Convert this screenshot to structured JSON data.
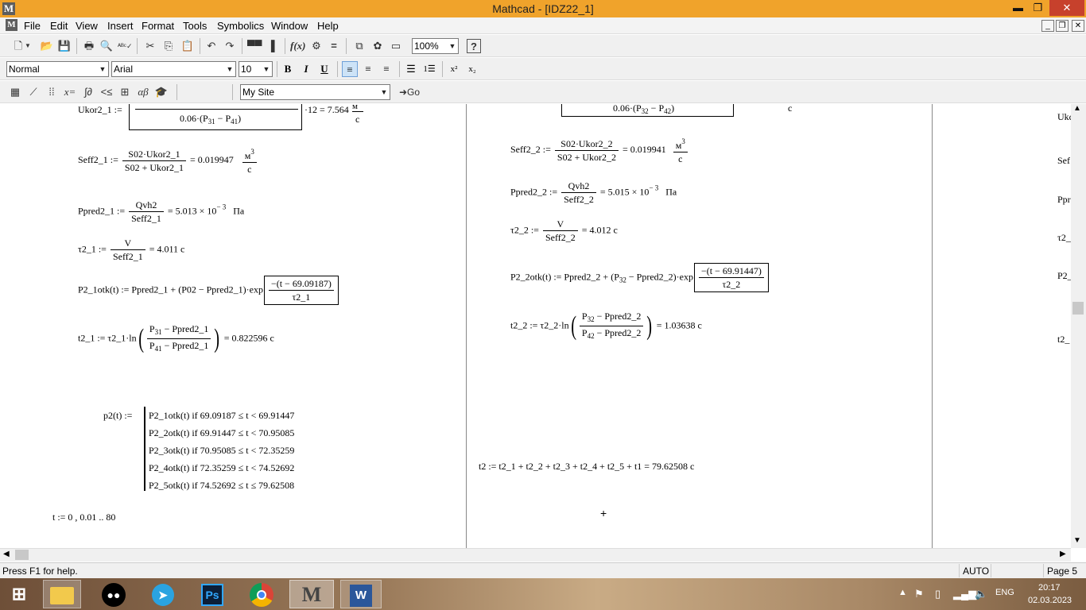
{
  "window": {
    "app_icon": "M",
    "title": "Mathcad - [IDZ22_1]",
    "minimize": "▬",
    "maximize": "❐",
    "close": "✕"
  },
  "menu": [
    "File",
    "Edit",
    "View",
    "Insert",
    "Format",
    "Tools",
    "Symbolics",
    "Window",
    "Help"
  ],
  "standard_toolbar": {
    "zoom": "100%",
    "icons": [
      "new-icon",
      "open-icon",
      "save-icon",
      "print-icon",
      "preview-icon",
      "spellcheck-icon",
      "cut-icon",
      "copy-icon",
      "paste-icon",
      "undo-icon",
      "redo-icon",
      "align-across-icon",
      "align-down-icon",
      "insert-function-icon",
      "insert-unit-icon",
      "calculate-icon",
      "resources-icon",
      "component-icon",
      "insert-region-icon",
      "help-icon"
    ]
  },
  "format_toolbar": {
    "style": "Normal",
    "font": "Arial",
    "size": "10",
    "bold": "B",
    "italic": "I",
    "underline": "U"
  },
  "math_toolbar": {
    "site": "My Site",
    "go": "Go"
  },
  "doc": {
    "ukor": {
      "lhs": "Ukor2_1 :=",
      "den_pre": "0.06·(P",
      "den_s1": "31",
      "den_mid": " − P",
      "den_s2": "41",
      "den_post": ")",
      "rhs": "·12 = 7.564",
      "unit_n": "м",
      "unit_d": "с"
    },
    "ukor_r": {
      "den_pre": "0.06·(P",
      "den_s1": "32",
      "den_mid": " − P",
      "den_s2": "42",
      "den_post": ")",
      "unit": "с"
    },
    "seff1": {
      "lhs": "Seff2_1 :=",
      "num": "S02·Ukor2_1",
      "den": "S02 + Ukor2_1",
      "rhs": "= 0.019947",
      "unit_n": "м",
      "unit_sup": "3",
      "unit_d": "с"
    },
    "ppred1": {
      "lhs": "Ppred2_1 :=",
      "num": "Qvh2",
      "den": "Seff2_1",
      "rhs": "= 5.013 × 10",
      "exp": "− 3",
      "unit": "Па"
    },
    "tau1": {
      "lhs": "τ2_1 :=",
      "num": "V",
      "den": "Seff2_1",
      "rhs": "= 4.011  с"
    },
    "p21": {
      "lhs": "P2_1otk(t) := Ppred2_1 + (P02 − Ppred2_1)·exp",
      "num": "−(t − 69.09187)",
      "den": "τ2_1"
    },
    "t21": {
      "lhs": "t2_1 := τ2_1·ln",
      "num_a": "P",
      "num_s": "31",
      "num_b": " − Ppred2_1",
      "den_a": "P",
      "den_s": "41",
      "den_b": " − Ppred2_1",
      "rhs": "= 0.822596   с"
    },
    "piecewise": {
      "lhs": "p2(t) :=",
      "rows": [
        "P2_1otk(t)   if   69.09187 ≤ t < 69.91447",
        "P2_2otk(t)   if   69.91447 ≤ t < 70.95085",
        "P2_3otk(t)   if   70.95085 ≤ t < 72.35259",
        "P2_4otk(t)   if   72.35259 ≤ t < 74.52692",
        "P2_5otk(t)   if   74.52692 ≤ t ≤ 79.62508"
      ]
    },
    "trange": "t := 0 , 0.01 .. 80",
    "seff2": {
      "lhs": "Seff2_2 :=",
      "num": "S02·Ukor2_2",
      "den": "S02 + Ukor2_2",
      "rhs": "= 0.019941",
      "unit_n": "м",
      "unit_sup": "3",
      "unit_d": "с"
    },
    "ppred2": {
      "lhs": "Ppred2_2 :=",
      "num": "Qvh2",
      "den": "Seff2_2",
      "rhs": "= 5.015 × 10",
      "exp": "− 3",
      "unit": "Па"
    },
    "tau2": {
      "lhs": "τ2_2 :=",
      "num": "V",
      "den": "Seff2_2",
      "rhs": "= 4.012  с"
    },
    "p22": {
      "lhs": "P2_2otk(t) := Ppred2_2 + (P",
      "s": "32",
      "mid": " − Ppred2_2)·exp",
      "num": "−(t − 69.91447)",
      "den": "τ2_2"
    },
    "t22": {
      "lhs": "t2_2 := τ2_2·ln",
      "num_a": "P",
      "num_s": "32",
      "num_b": " − Ppred2_2",
      "den_a": "P",
      "den_s": "42",
      "den_b": " − Ppred2_2",
      "rhs": "= 1.03638   с"
    },
    "t2sum": "t2 := t2_1 + t2_2 + t2_3 + t2_4 + t2_5 + t1 = 79.62508   с",
    "cursor": "+",
    "right_edge": [
      "Ukc",
      "Sef",
      "Ppr",
      "τ2_",
      "P2_",
      "t2_"
    ]
  },
  "status": {
    "help": "Press F1 for help.",
    "mode": "AUTO",
    "page": "Page 5"
  },
  "taskbar": {
    "apps": [
      "windows-start-icon",
      "file-explorer-icon",
      "tripadvisor-icon",
      "telegram-icon",
      "photoshop-icon",
      "chrome-icon",
      "mathcad-icon",
      "word-icon"
    ],
    "ps": "Ps",
    "mathcad": "M",
    "word": "W",
    "lang": "ENG",
    "time": "20:17",
    "date": "02.03.2023"
  }
}
